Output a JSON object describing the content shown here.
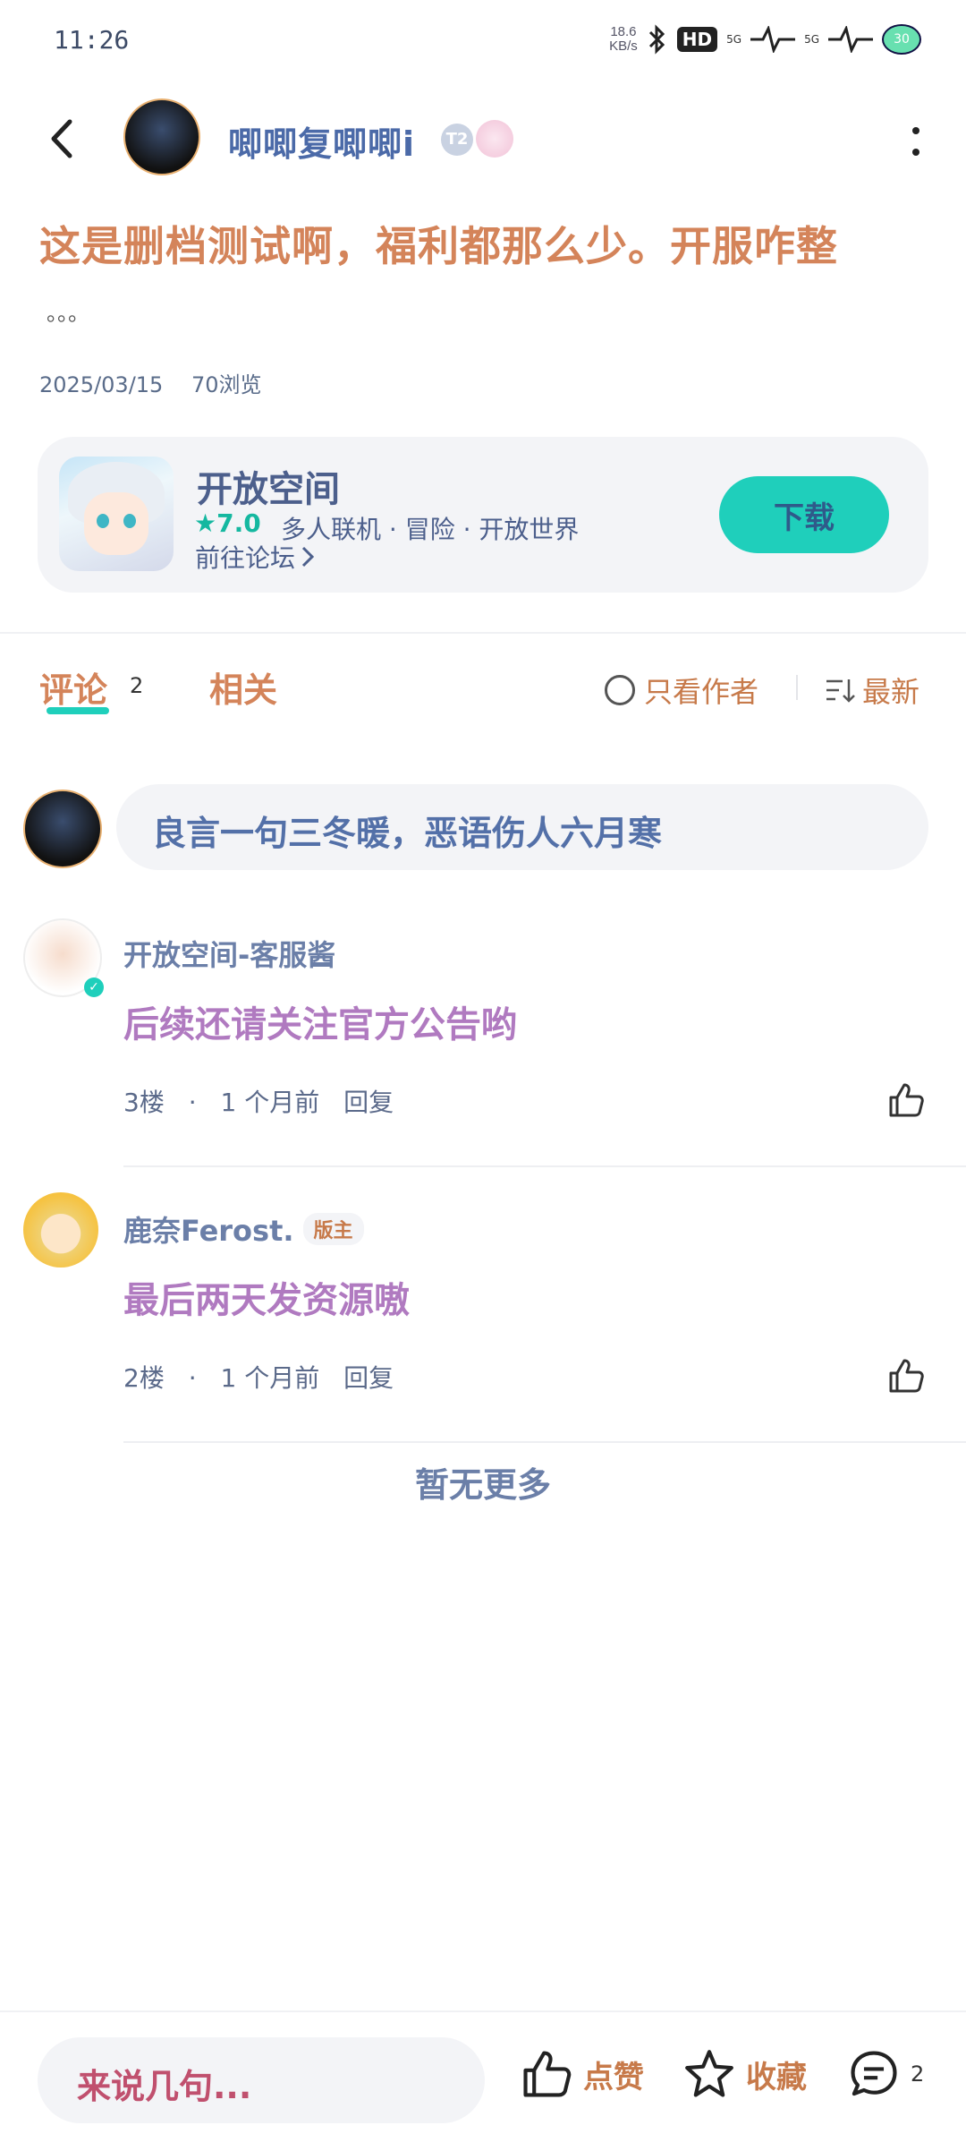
{
  "status_bar": {
    "time": "11:26",
    "net_speed_value": "18.6",
    "net_speed_unit": "KB/s",
    "hd_label": "HD",
    "signal1": "5G",
    "signal2": "5G",
    "battery": "30"
  },
  "header": {
    "author_name": "唧唧复唧唧i",
    "level_badge": "T2"
  },
  "post": {
    "title": "这是删档测试啊，福利都那么少。开服咋整",
    "ellipsis": "。。。",
    "date": "2025/03/15",
    "views": "70浏览"
  },
  "forum_card": {
    "name": "开放空间",
    "rating": "★7.0",
    "tags": "多人联机 · 冒险 · 开放世界",
    "link_label": "前往论坛",
    "download_label": "下载"
  },
  "tabs": {
    "comments_label": "评论",
    "comments_count": "2",
    "related_label": "相关",
    "author_only_label": "只看作者",
    "sort_label": "最新"
  },
  "comment_input_top": {
    "placeholder": "良言一句三冬暖，恶语伤人六月寒"
  },
  "comments": [
    {
      "author": "开放空间-客服酱",
      "tag": "",
      "text": "后续还请关注官方公告哟",
      "floor": "3楼",
      "dot": "·",
      "time": "1 个月前",
      "reply": "回复"
    },
    {
      "author": "鹿奈Ferost.",
      "tag": "版主",
      "text": "最后两天发资源嗷",
      "floor": "2楼",
      "dot": "·",
      "time": "1 个月前",
      "reply": "回复"
    }
  ],
  "no_more": "暂无更多",
  "bottom_bar": {
    "input_placeholder": "来说几句...",
    "like_label": "点赞",
    "favorite_label": "收藏",
    "comment_count": "2"
  },
  "colors": {
    "accent": "#1fcfbb",
    "card_bg": "#f3f4f7"
  }
}
